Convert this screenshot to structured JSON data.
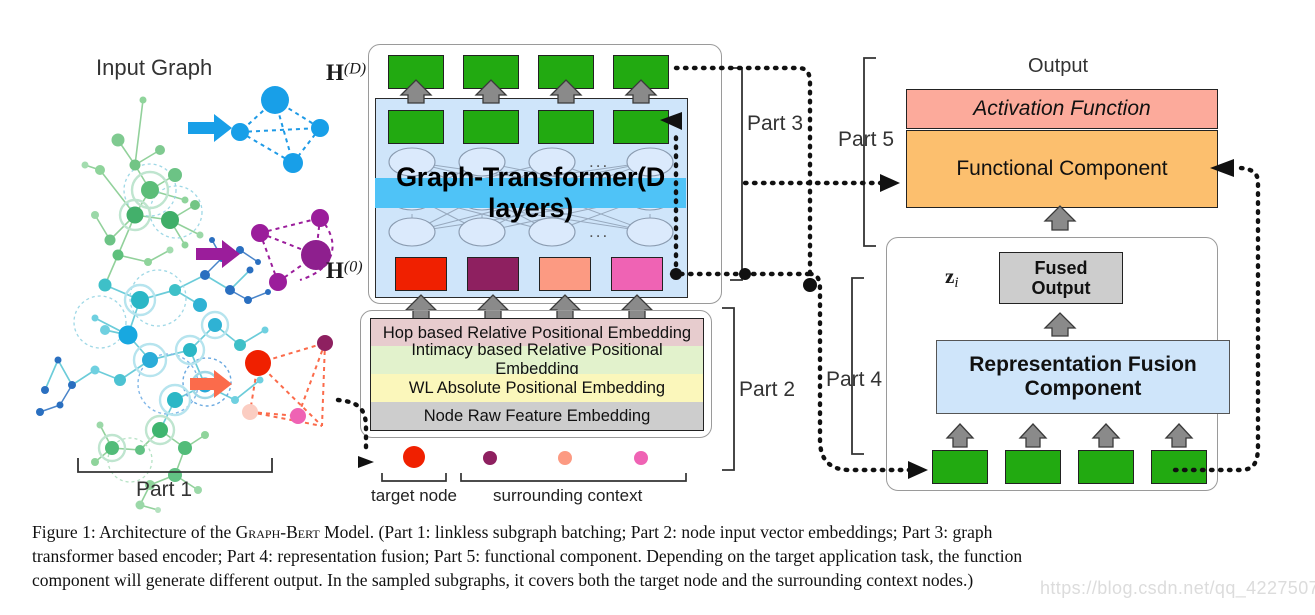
{
  "figure": {
    "caption_number": "Figure 1:",
    "caption_text": "Architecture of the Graph-Bert Model. (Part 1: linkless subgraph batching; Part 2: node input vector embeddings; Part 3: graph transformer based encoder; Part 4: representation fusion; Part 5: functional component. Depending on the target application task, the function component will generate different output. In the sampled subgraphs, it covers both the target node and the surrounding context nodes.)",
    "caption_line1_a": "Figure 1: Architecture of the ",
    "caption_line1_b": "Graph-Bert",
    "caption_line1_c": " Model. (Part 1: linkless subgraph batching; Part 2: node input vector embeddings; Part 3: graph",
    "caption_line2": "transformer based encoder; Part 4: representation fusion; Part 5: functional component. Depending on the target application task, the function",
    "caption_line3": "component will generate different output. In the sampled subgraphs, it covers both the target node and the surrounding context nodes.)",
    "watermark": "https://blog.csdn.net/qq_42275073"
  },
  "part1": {
    "title": "Input Graph",
    "bracket_label": "Part 1",
    "subgraphs": [
      {
        "name": "blue-subgraph",
        "color": "#1e9ae6",
        "arrow_color": "#1e9ae6"
      },
      {
        "name": "purple-subgraph",
        "color": "#9b1d9b",
        "arrow_color": "#9b1d9b"
      },
      {
        "name": "red-subgraph",
        "color": "#f0422a",
        "arrow_color": "#fb6b4b"
      }
    ]
  },
  "part2": {
    "bracket_label": "Part 2",
    "layers": [
      {
        "label": "Hop based Relative Positional Embedding",
        "color": "#e7ccce"
      },
      {
        "label": "Intimacy based Relative Positional Embedding",
        "color": "#e2f2cc"
      },
      {
        "label": "WL Absolute Positional Embedding",
        "color": "#fbf7bb"
      },
      {
        "label": "Node Raw Feature Embedding",
        "color": "#cdcdcd"
      }
    ],
    "node_legend": [
      {
        "label": "target node",
        "dots": [
          {
            "color": "#f02000",
            "r": 11
          }
        ]
      },
      {
        "label": "surrounding context",
        "dots": [
          {
            "color": "#8e2060",
            "r": 7
          },
          {
            "color": "#fc9a82",
            "r": 7
          },
          {
            "color": "#ef63b4",
            "r": 7
          }
        ]
      }
    ]
  },
  "part3": {
    "bracket_label": "Part 3",
    "transformer_label": "Graph-Transformer(D layers)",
    "h_top_label": "H",
    "h_top_sup": "(D)",
    "h_bottom_label": "H",
    "h_bottom_sup": "(0)",
    "ellipsis": "...",
    "output_block_color": "#22aa11",
    "panel_color": "#cfe5fa",
    "highlight_color": "#4fc3f7",
    "input_blocks": [
      {
        "name": "target-node-embedding",
        "color": "#f02000"
      },
      {
        "name": "context-node-embedding-1",
        "color": "#8e2060"
      },
      {
        "name": "context-node-embedding-2",
        "color": "#fc9a82"
      },
      {
        "name": "context-node-embedding-3",
        "color": "#ef63b4"
      }
    ]
  },
  "part4": {
    "bracket_label": "Part 4",
    "fusion_label": "Representation Fusion Component",
    "fusion_color": "#cfe5fa",
    "fused_output_label": "Fused\nOutput",
    "fused_output_line1": "Fused",
    "fused_output_line2": "Output",
    "fused_output_color": "#cdcdcd",
    "z_symbol": "z",
    "z_sub": "i",
    "input_block_color": "#22aa11",
    "input_block_count": 4
  },
  "part5": {
    "bracket_label": "Part 5",
    "output_title": "Output",
    "activation_label": "Activation Function",
    "activation_color": "#fcaa9b",
    "functional_label": "Functional Component",
    "functional_color": "#fcbf6e"
  }
}
